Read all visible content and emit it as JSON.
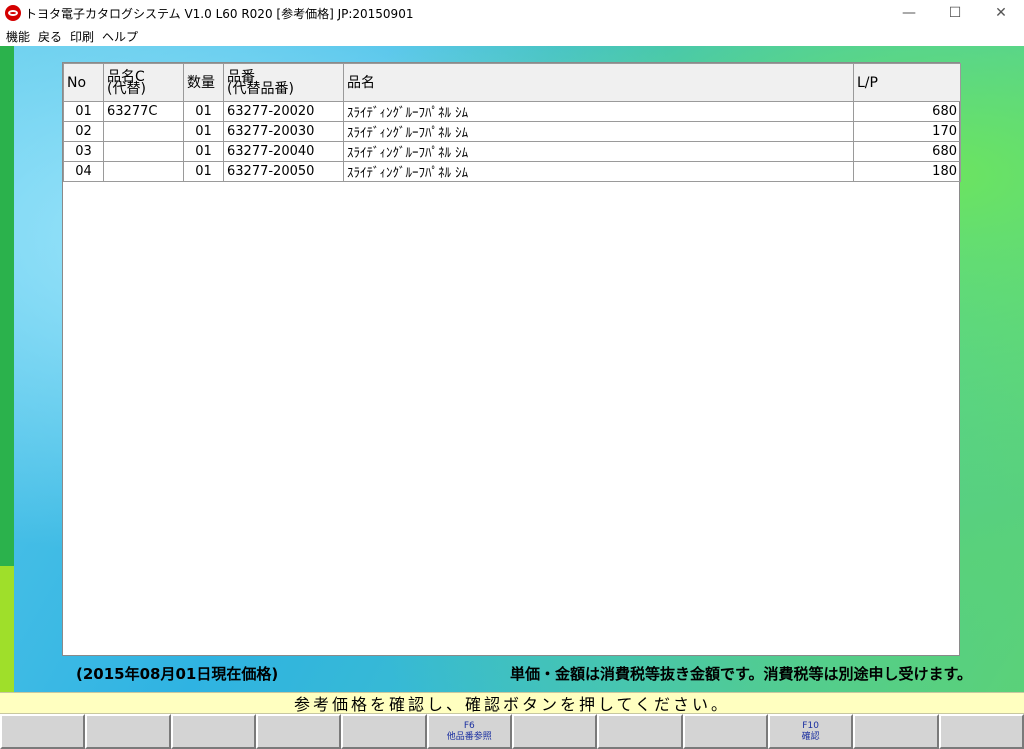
{
  "window": {
    "title": "トヨタ電子カタログシステム V1.0 L60 R020 [参考価格] JP:20150901",
    "minimize": "—",
    "maximize": "☐",
    "close": "✕"
  },
  "menu": {
    "items": [
      "機能",
      "戻る",
      "印刷",
      "ヘルプ"
    ]
  },
  "table": {
    "headers": {
      "no": "No",
      "hinmei_c_1": "品名C",
      "hinmei_c_2": "(代替)",
      "qty": "数量",
      "hinban_1": "品番",
      "hinban_2": "(代替品番)",
      "name": "品名",
      "lp": "L/P"
    },
    "rows": [
      {
        "no": "01",
        "code": "63277C",
        "qty": "01",
        "part": "63277-20020",
        "name": "ｽﾗｲﾃﾞｨﾝｸﾞﾙｰﾌﾊﾟﾈﾙ ｼﾑ",
        "lp": "680"
      },
      {
        "no": "02",
        "code": "",
        "qty": "01",
        "part": "63277-20030",
        "name": "ｽﾗｲﾃﾞｨﾝｸﾞﾙｰﾌﾊﾟﾈﾙ ｼﾑ",
        "lp": "170"
      },
      {
        "no": "03",
        "code": "",
        "qty": "01",
        "part": "63277-20040",
        "name": "ｽﾗｲﾃﾞｨﾝｸﾞﾙｰﾌﾊﾟﾈﾙ ｼﾑ",
        "lp": "680"
      },
      {
        "no": "04",
        "code": "",
        "qty": "01",
        "part": "63277-20050",
        "name": "ｽﾗｲﾃﾞｨﾝｸﾞﾙｰﾌﾊﾟﾈﾙ ｼﾑ",
        "lp": "180"
      }
    ]
  },
  "info": {
    "price_date": "(2015年08月01日現在価格)",
    "tax_note": "単価・金額は消費税等抜き金額です。消費税等は別途申し受けます。"
  },
  "message": "参考価格を確認し、確認ボタンを押してください。",
  "fkeys": [
    {
      "key": "",
      "label": ""
    },
    {
      "key": "",
      "label": ""
    },
    {
      "key": "",
      "label": ""
    },
    {
      "key": "",
      "label": ""
    },
    {
      "key": "",
      "label": ""
    },
    {
      "key": "F6",
      "label": "他品番参照"
    },
    {
      "key": "",
      "label": ""
    },
    {
      "key": "",
      "label": ""
    },
    {
      "key": "",
      "label": ""
    },
    {
      "key": "F10",
      "label": "確認"
    },
    {
      "key": "",
      "label": ""
    },
    {
      "key": "",
      "label": ""
    }
  ],
  "colors": {
    "accent_green": "#2bb24c",
    "message_bg": "#ffffc0",
    "fkey_text": "#1a2fa0"
  }
}
